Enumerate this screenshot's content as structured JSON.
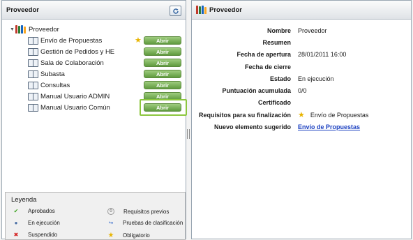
{
  "left_panel": {
    "title": "Proveedor",
    "tree_root": "Proveedor",
    "items": [
      {
        "label": "Envío de Propuestas",
        "button": "Abrir",
        "starred": true
      },
      {
        "label": "Gestión de Pedidos y HE",
        "button": "Abrir",
        "starred": false
      },
      {
        "label": "Sala de Colaboración",
        "button": "Abrir",
        "starred": false
      },
      {
        "label": "Subasta",
        "button": "Abrir",
        "starred": false
      },
      {
        "label": "Consultas",
        "button": "Abrir",
        "starred": false
      },
      {
        "label": "Manual Usuario ADMIN",
        "button": "Abrir",
        "starred": false
      },
      {
        "label": "Manual Usuario Común",
        "button": "Abrir",
        "starred": false
      }
    ]
  },
  "legend": {
    "title": "Leyenda",
    "items": [
      {
        "label": "Aprobados",
        "icon": "check-icon",
        "glyph": "✔",
        "color": "#3ea320"
      },
      {
        "label": "Requisitos previos",
        "icon": "zero-circle-icon",
        "glyph": "0",
        "color": "#444444"
      },
      {
        "label": "En ejecución",
        "icon": "dot-icon",
        "glyph": "●",
        "color": "#4a6fa5"
      },
      {
        "label": "Pruebas de clasificación",
        "icon": "curve-arrow-icon",
        "glyph": "↪",
        "color": "#2a62c9"
      },
      {
        "label": "Suspendido",
        "icon": "cross-icon",
        "glyph": "✖",
        "color": "#d42020"
      },
      {
        "label": "Obligatorio",
        "icon": "star-icon",
        "glyph": "★",
        "color": "#e8b400"
      }
    ]
  },
  "right_panel": {
    "title": "Proveedor",
    "fields": [
      {
        "label": "Nombre",
        "value": "Proveedor"
      },
      {
        "label": "Resumen",
        "value": ""
      },
      {
        "label": "Fecha de apertura",
        "value": "28/01/2011 16:00"
      },
      {
        "label": "Fecha de cierre",
        "value": ""
      },
      {
        "label": "Estado",
        "value": "En ejecución"
      },
      {
        "label": "Puntuación acumulada",
        "value": "0/0"
      },
      {
        "label": "Certificado",
        "value": ""
      },
      {
        "label": "Requisitos para su finalización",
        "value": "Envío de Propuestas"
      },
      {
        "label": "Nuevo elemento sugerido",
        "value": "Envío de Propuestas"
      }
    ]
  },
  "colors": {
    "button_green": "#6fa84c",
    "focus_outline": "#8cc63e",
    "link": "#1a3fc0",
    "star": "#e8b400"
  }
}
